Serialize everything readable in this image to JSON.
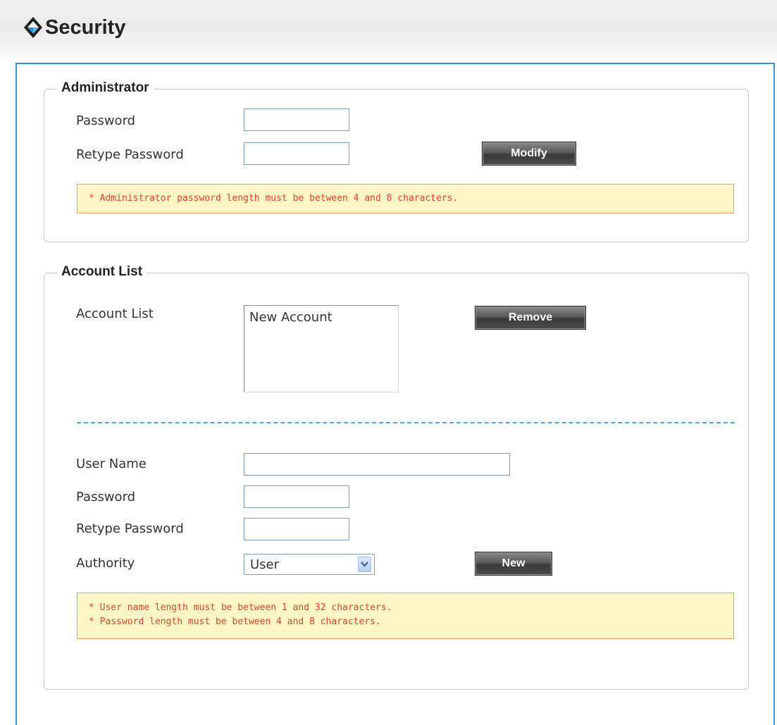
{
  "header": {
    "title": "Security",
    "icon": "diamond-logo-icon"
  },
  "administrator": {
    "legend": "Administrator",
    "password_label": "Password",
    "password_value": "",
    "retype_label": "Retype Password",
    "retype_value": "",
    "modify_label": "Modify",
    "note": "* Administrator password length must be between 4 and 8 characters."
  },
  "account_list": {
    "legend": "Account List",
    "list_label": "Account List",
    "items": [
      "New Account"
    ],
    "remove_label": "Remove",
    "username_label": "User Name",
    "username_value": "",
    "password_label": "Password",
    "password_value": "",
    "retype_label": "Retype Password",
    "retype_value": "",
    "authority_label": "Authority",
    "authority_value": "User",
    "new_label": "New",
    "notes": [
      "* User name length must be between 1 and 32 characters.",
      "* Password length must be between 4 and 8 characters."
    ]
  },
  "colors": {
    "panel_border": "#2f95d8",
    "note_background": "#fff6c8",
    "note_border": "#f0a060",
    "note_text": "#e0402a",
    "divider": "#4aa6de"
  }
}
